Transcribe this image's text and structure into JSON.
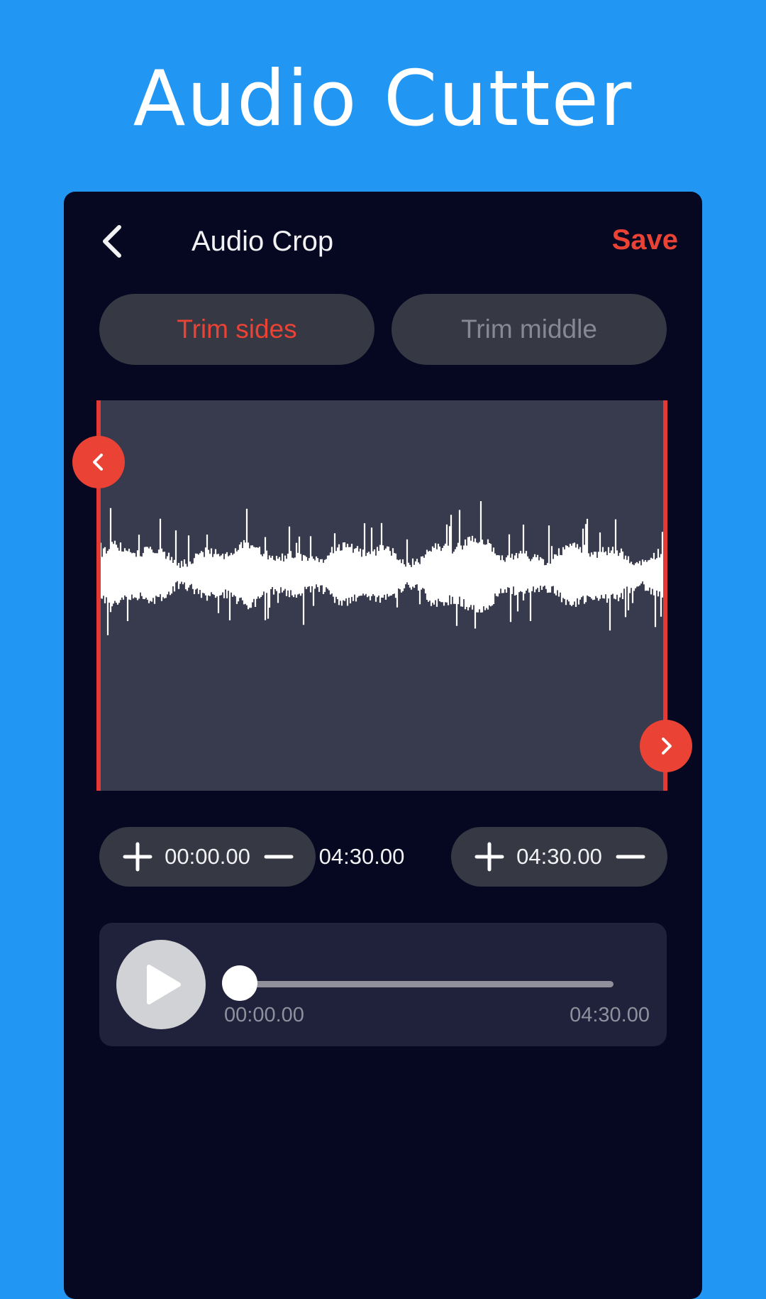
{
  "hero": {
    "title": "Audio Cutter"
  },
  "appbar": {
    "back_icon": "chevron-left-icon",
    "title": "Audio Crop",
    "save_label": "Save"
  },
  "colors": {
    "background": "#2196F3",
    "screen": "#060720",
    "accent": "#EA4335",
    "surface": "#363843",
    "waveform_bg": "#383A4D",
    "waveform": "#FFFFFF"
  },
  "tabs": [
    {
      "label": "Trim sides",
      "selected": true
    },
    {
      "label": "Trim middle",
      "selected": false
    }
  ],
  "waveform": {
    "start_handle_icon": "chevron-left-icon",
    "end_handle_icon": "chevron-right-icon"
  },
  "trim": {
    "start": {
      "value": "00:00.00",
      "plus_icon": "plus-icon",
      "minus_icon": "minus-icon"
    },
    "duration": "04:30.00",
    "end": {
      "value": "04:30.00",
      "plus_icon": "plus-icon",
      "minus_icon": "minus-icon"
    }
  },
  "player": {
    "play_icon": "play-icon",
    "current_time": "00:00.00",
    "total_time": "04:30.00",
    "progress": 0
  }
}
